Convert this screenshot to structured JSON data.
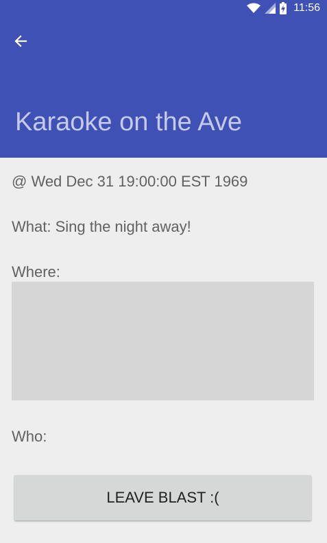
{
  "status_bar": {
    "time": "11:56",
    "icons": [
      "wifi-icon",
      "signal-icon",
      "battery-charging-icon"
    ]
  },
  "app_bar": {
    "back_icon": "arrow-back-icon",
    "title": "Karaoke on the Ave",
    "color": "#3f51b5",
    "title_color": "#c5cae9"
  },
  "details": {
    "when": "@ Wed Dec 31 19:00:00 EST 1969",
    "what": "What: Sing the night away!",
    "where_label": "Where:",
    "who_label": "Who:"
  },
  "actions": {
    "leave_label": "LEAVE BLAST :("
  }
}
